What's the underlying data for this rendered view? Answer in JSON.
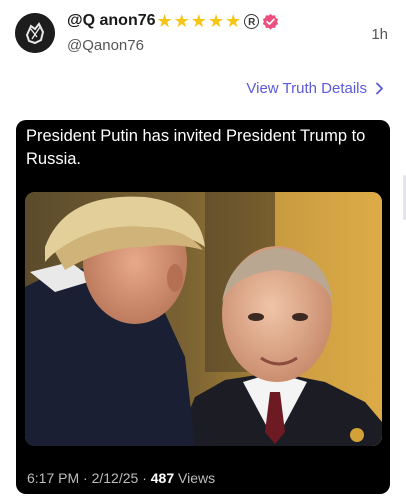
{
  "post": {
    "display_name": "@Q anon76",
    "handle": "@Qanon76",
    "time_ago": "1h",
    "badges": [
      "star-icon",
      "star-icon",
      "star-icon",
      "star-icon",
      "star-icon",
      "registered-icon",
      "verified-icon"
    ],
    "details_link": "View Truth Details"
  },
  "card": {
    "text": "President Putin has invited President Trump to Russia.",
    "time": "6:17 PM",
    "date": "2/12/25",
    "views_count": "487",
    "views_label": "Views"
  },
  "colors": {
    "accent": "#5a5ad8",
    "verified": "#ea4f7f",
    "star": "#f5c518"
  }
}
